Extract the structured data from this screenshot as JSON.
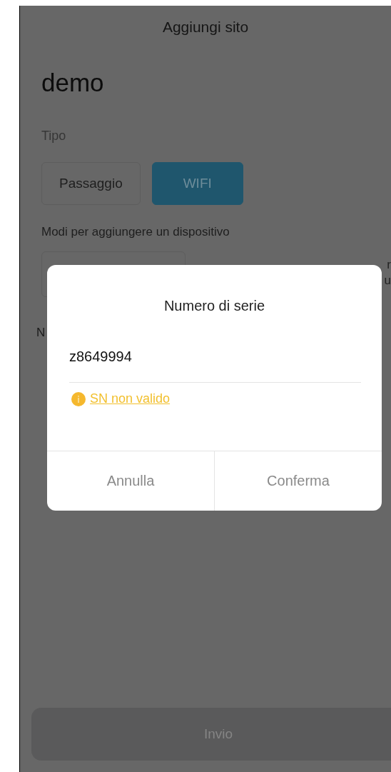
{
  "header": {
    "title": "Aggiungi sito"
  },
  "site_name": "demo",
  "type": {
    "label": "Tipo",
    "options": [
      {
        "label": "Passaggio",
        "selected": false
      },
      {
        "label": "WIFI",
        "selected": true
      }
    ]
  },
  "add_methods": {
    "label": "Modi per aggiungere un dispositivo",
    "option_fragments": [
      "r",
      "u"
    ]
  },
  "field_3": {
    "label_fragment": "N"
  },
  "dialog": {
    "title": "Numero di serie",
    "input_value": "z8649994",
    "error": "SN non valido",
    "buttons": [
      "Annulla",
      "Conferma"
    ]
  },
  "submit": {
    "label": "Invio",
    "disabled": true
  }
}
